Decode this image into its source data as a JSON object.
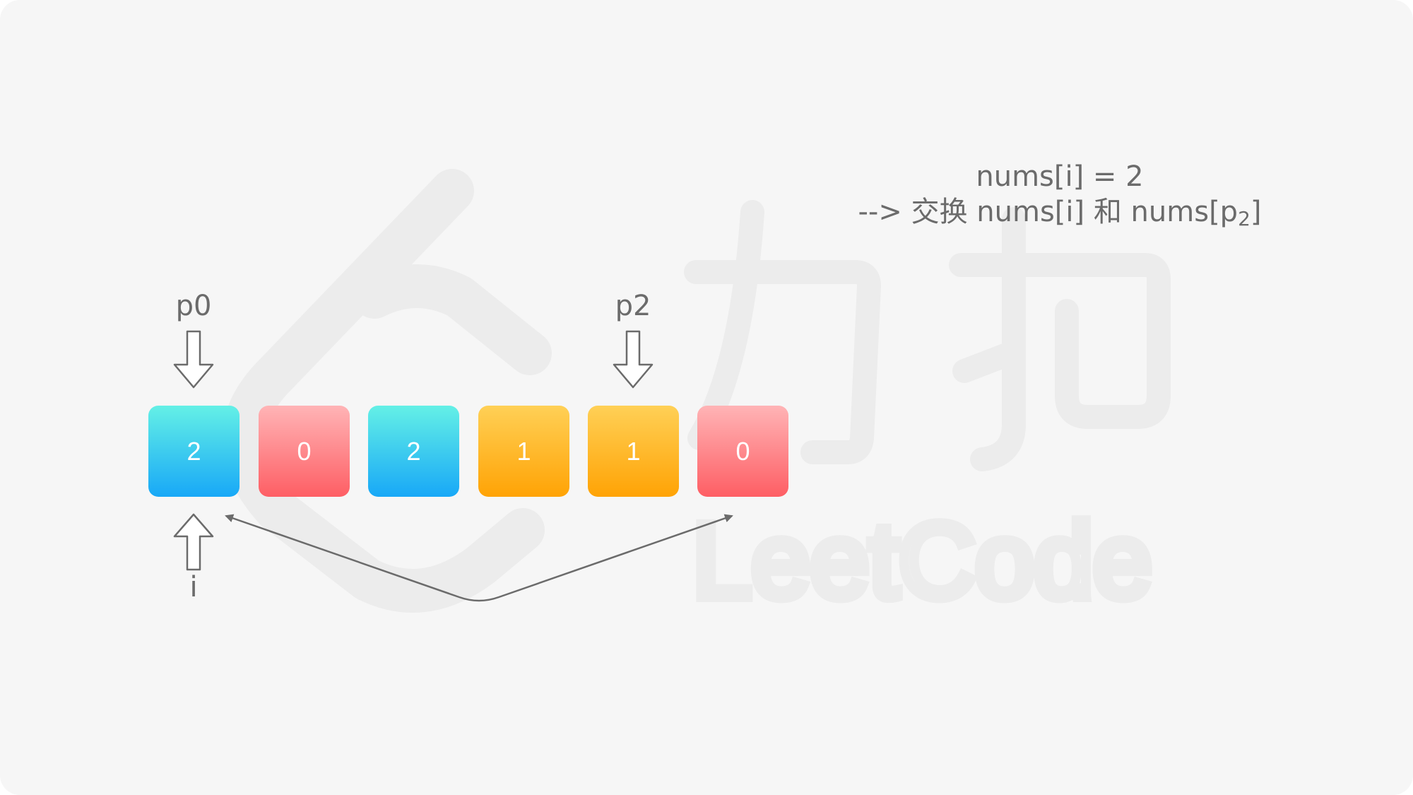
{
  "array": [
    {
      "value": "2",
      "color": "blue"
    },
    {
      "value": "0",
      "color": "red"
    },
    {
      "value": "2",
      "color": "blue"
    },
    {
      "value": "1",
      "color": "orange"
    },
    {
      "value": "1",
      "color": "orange"
    },
    {
      "value": "0",
      "color": "red"
    }
  ],
  "pointers": {
    "p0": "p0",
    "p2": "p2",
    "i": "i"
  },
  "note": {
    "line1": "nums[i] = 2",
    "line2_prefix": "--> 交换 nums[i] 和 nums[p",
    "line2_sub": "2",
    "line2_suffix": "]"
  },
  "watermark": {
    "brand_text": "LeetCode",
    "brand_cn": "力扣"
  },
  "colors": {
    "background": "#f6f6f6",
    "text": "#6b6b6b",
    "blue_top": "#64f0e6",
    "blue_bottom": "#18a8f7",
    "red_top": "#ffb4b6",
    "red_bottom": "#fe5e64",
    "orange_top": "#ffd056",
    "orange_bottom": "#ffa305"
  }
}
